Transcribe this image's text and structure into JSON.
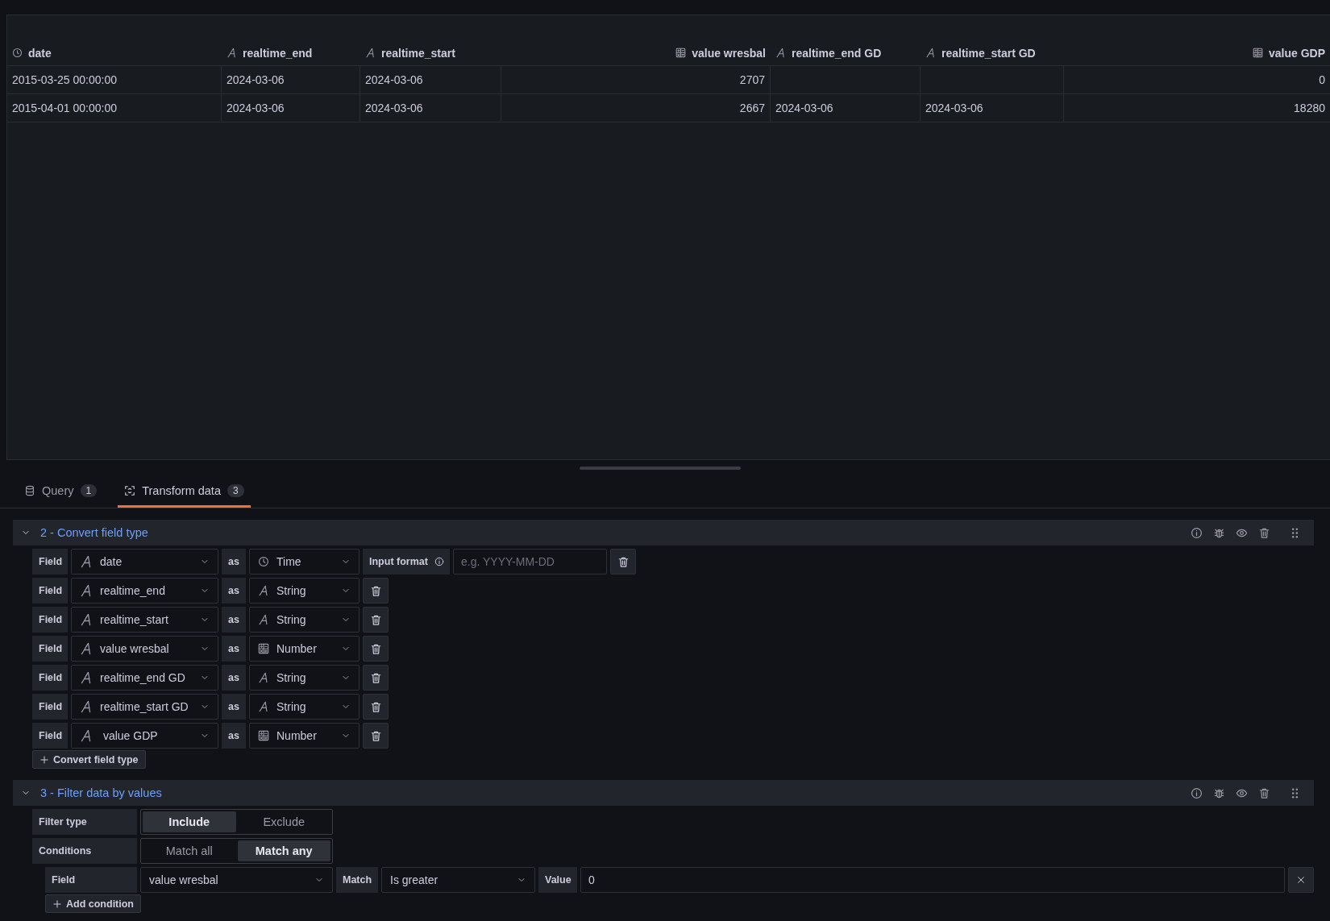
{
  "table": {
    "columns": [
      {
        "label": "date",
        "kind": "time"
      },
      {
        "label": "realtime_end",
        "kind": "string"
      },
      {
        "label": "realtime_start",
        "kind": "string"
      },
      {
        "label": "value wresbal",
        "kind": "number"
      },
      {
        "label": "realtime_end GD",
        "kind": "string"
      },
      {
        "label": "realtime_start GD",
        "kind": "string"
      },
      {
        "label": "value GDP",
        "kind": "number"
      }
    ],
    "rows": [
      [
        "2015-03-25 00:00:00",
        "2024-03-06",
        "2024-03-06",
        "2707",
        null,
        null,
        "0"
      ],
      [
        "2015-04-01 00:00:00",
        "2024-03-06",
        "2024-03-06",
        "2667",
        "2024-03-06",
        "2024-03-06",
        "18280"
      ]
    ]
  },
  "tabs": [
    {
      "label": "Query",
      "count": "1",
      "selected": false
    },
    {
      "label": "Transform data",
      "count": "3",
      "selected": true
    }
  ],
  "transformations": [
    {
      "kind": "convert",
      "title": "2 - Convert field type",
      "expanded": true,
      "conversions": [
        {
          "label": "Field",
          "field": "date",
          "as_label": "as",
          "target": "Time",
          "kind": "time",
          "input_format_label": "Input format",
          "input_format_placeholder": "e.g. YYYY-MM-DD"
        },
        {
          "label": "Field",
          "field": "realtime_end",
          "as_label": "as",
          "target": "String",
          "kind": "string"
        },
        {
          "label": "Field",
          "field": "realtime_start",
          "as_label": "as",
          "target": "String",
          "kind": "string"
        },
        {
          "label": "Field",
          "field": "value wresbal",
          "as_label": "as",
          "target": "Number",
          "kind": "number"
        },
        {
          "label": "Field",
          "field": "realtime_end GD",
          "as_label": "as",
          "target": "String",
          "kind": "string"
        },
        {
          "label": "Field",
          "field": "realtime_start GD",
          "as_label": "as",
          "target": "String",
          "kind": "string"
        },
        {
          "label": "Field",
          "field": " value GDP",
          "as_label": "as",
          "target": "Number",
          "kind": "number"
        }
      ],
      "add_button": "Convert field type"
    },
    {
      "kind": "filter",
      "title": "3 - Filter data by values",
      "expanded": true,
      "filter_type": {
        "label": "Filter type",
        "options": [
          {
            "label": "Include",
            "selected": true
          },
          {
            "label": "Exclude",
            "selected": false
          }
        ]
      },
      "conditions": {
        "label": "Conditions",
        "options": [
          {
            "label": "Match all",
            "selected": false
          },
          {
            "label": "Match any",
            "selected": true
          }
        ]
      },
      "condition_rows": [
        {
          "label": "Field",
          "field": "value wresbal",
          "match_label": "Match",
          "match": "Is greater",
          "value_label": "Value",
          "value": "0"
        }
      ],
      "add_button": "Add condition"
    }
  ]
}
